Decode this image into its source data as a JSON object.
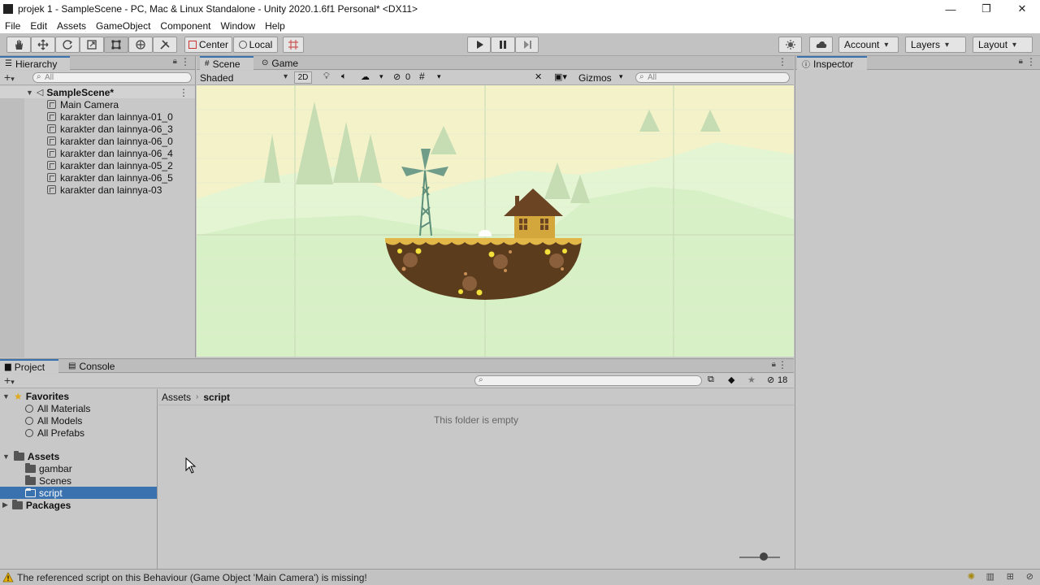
{
  "window": {
    "title": "projek 1 - SampleScene - PC, Mac & Linux Standalone - Unity 2020.1.6f1 Personal* <DX11>"
  },
  "menu": [
    "File",
    "Edit",
    "Assets",
    "GameObject",
    "Component",
    "Window",
    "Help"
  ],
  "toolbar": {
    "pivot_label": "Center",
    "space_label": "Local",
    "account_label": "Account",
    "layers_label": "Layers",
    "layout_label": "Layout"
  },
  "hierarchy": {
    "tab_label": "Hierarchy",
    "search_placeholder": "All",
    "scene_name": "SampleScene*",
    "items": [
      "Main Camera",
      "karakter dan lainnya-01_0",
      "karakter dan lainnya-06_3",
      "karakter dan lainnya-06_0",
      "karakter dan lainnya-06_4",
      "karakter dan lainnya-05_2",
      "karakter dan lainnya-06_5",
      "karakter dan lainnya-03"
    ]
  },
  "scene": {
    "tabs": [
      "Scene",
      "Game"
    ],
    "shading_mode": "Shaded",
    "mode_2d": "2D",
    "hidden_count": "0",
    "gizmos_label": "Gizmos",
    "search_placeholder": "All"
  },
  "inspector": {
    "tab_label": "Inspector"
  },
  "project": {
    "tabs": [
      "Project",
      "Console"
    ],
    "hidden_count": "18",
    "favorites_label": "Favorites",
    "favorites": [
      "All Materials",
      "All Models",
      "All Prefabs"
    ],
    "assets_label": "Assets",
    "asset_folders": [
      "gambar",
      "Scenes",
      "script"
    ],
    "selected_folder": "script",
    "packages_label": "Packages",
    "breadcrumb": [
      "Assets",
      "script"
    ],
    "empty_message": "This folder is empty"
  },
  "status": {
    "message": "The referenced script on this Behaviour (Game Object 'Main Camera') is missing!"
  },
  "colors": {
    "selection": "#3a72b0",
    "sky": "#f4f1c8",
    "ground": "#d6f2c6",
    "island": "#5b3d1e",
    "house": "#6b4424",
    "gold": "#e2b748"
  }
}
